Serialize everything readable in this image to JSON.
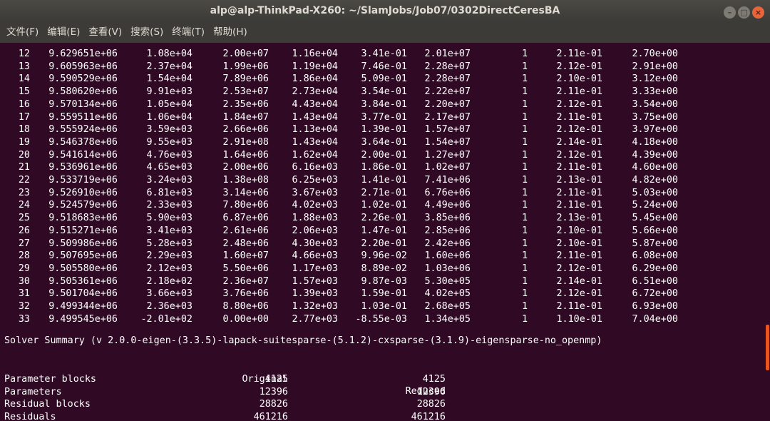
{
  "window": {
    "title": "alp@alp-ThinkPad-X260: ~/SlamJobs/Job07/0302DirectCeresBA",
    "buttons": {
      "minimize": "–",
      "maximize": "□",
      "close": "×"
    }
  },
  "menu": [
    "文件(F)",
    "编辑(E)",
    "查看(V)",
    "搜索(S)",
    "终端(T)",
    "帮助(H)"
  ],
  "iterations": [
    [
      "12",
      "9.629651e+06",
      "1.08e+04",
      "2.00e+07",
      "1.16e+04",
      "3.41e-01",
      "2.01e+07",
      "1",
      "2.11e-01",
      "2.70e+00"
    ],
    [
      "13",
      "9.605963e+06",
      "2.37e+04",
      "1.99e+06",
      "1.19e+04",
      "7.46e-01",
      "2.28e+07",
      "1",
      "2.12e-01",
      "2.91e+00"
    ],
    [
      "14",
      "9.590529e+06",
      "1.54e+04",
      "7.89e+06",
      "1.86e+04",
      "5.09e-01",
      "2.28e+07",
      "1",
      "2.10e-01",
      "3.12e+00"
    ],
    [
      "15",
      "9.580620e+06",
      "9.91e+03",
      "2.53e+07",
      "2.73e+04",
      "3.54e-01",
      "2.22e+07",
      "1",
      "2.11e-01",
      "3.33e+00"
    ],
    [
      "16",
      "9.570134e+06",
      "1.05e+04",
      "2.35e+06",
      "4.43e+04",
      "3.84e-01",
      "2.20e+07",
      "1",
      "2.12e-01",
      "3.54e+00"
    ],
    [
      "17",
      "9.559511e+06",
      "1.06e+04",
      "1.84e+07",
      "1.43e+04",
      "3.77e-01",
      "2.17e+07",
      "1",
      "2.11e-01",
      "3.75e+00"
    ],
    [
      "18",
      "9.555924e+06",
      "3.59e+03",
      "2.66e+06",
      "1.13e+04",
      "1.39e-01",
      "1.57e+07",
      "1",
      "2.12e-01",
      "3.97e+00"
    ],
    [
      "19",
      "9.546378e+06",
      "9.55e+03",
      "2.91e+08",
      "1.43e+04",
      "3.64e-01",
      "1.54e+07",
      "1",
      "2.14e-01",
      "4.18e+00"
    ],
    [
      "20",
      "9.541614e+06",
      "4.76e+03",
      "1.64e+06",
      "1.62e+04",
      "2.00e-01",
      "1.27e+07",
      "1",
      "2.12e-01",
      "4.39e+00"
    ],
    [
      "21",
      "9.536961e+06",
      "4.65e+03",
      "2.00e+06",
      "6.16e+03",
      "1.86e-01",
      "1.02e+07",
      "1",
      "2.11e-01",
      "4.60e+00"
    ],
    [
      "22",
      "9.533719e+06",
      "3.24e+03",
      "1.38e+08",
      "6.25e+03",
      "1.41e-01",
      "7.41e+06",
      "1",
      "2.13e-01",
      "4.82e+00"
    ],
    [
      "23",
      "9.526910e+06",
      "6.81e+03",
      "3.14e+06",
      "3.67e+03",
      "2.71e-01",
      "6.76e+06",
      "1",
      "2.11e-01",
      "5.03e+00"
    ],
    [
      "24",
      "9.524579e+06",
      "2.33e+03",
      "7.80e+06",
      "4.02e+03",
      "1.02e-01",
      "4.49e+06",
      "1",
      "2.11e-01",
      "5.24e+00"
    ],
    [
      "25",
      "9.518683e+06",
      "5.90e+03",
      "6.87e+06",
      "1.88e+03",
      "2.26e-01",
      "3.85e+06",
      "1",
      "2.13e-01",
      "5.45e+00"
    ],
    [
      "26",
      "9.515271e+06",
      "3.41e+03",
      "2.61e+06",
      "2.06e+03",
      "1.47e-01",
      "2.85e+06",
      "1",
      "2.10e-01",
      "5.66e+00"
    ],
    [
      "27",
      "9.509986e+06",
      "5.28e+03",
      "2.48e+06",
      "4.30e+03",
      "2.20e-01",
      "2.42e+06",
      "1",
      "2.10e-01",
      "5.87e+00"
    ],
    [
      "28",
      "9.507695e+06",
      "2.29e+03",
      "1.60e+07",
      "4.66e+03",
      "9.96e-02",
      "1.60e+06",
      "1",
      "2.11e-01",
      "6.08e+00"
    ],
    [
      "29",
      "9.505580e+06",
      "2.12e+03",
      "5.50e+06",
      "1.17e+03",
      "8.89e-02",
      "1.03e+06",
      "1",
      "2.12e-01",
      "6.29e+00"
    ],
    [
      "30",
      "9.505361e+06",
      "2.18e+02",
      "2.36e+07",
      "1.57e+03",
      "9.87e-03",
      "5.30e+05",
      "1",
      "2.14e-01",
      "6.51e+00"
    ],
    [
      "31",
      "9.501704e+06",
      "3.66e+03",
      "3.76e+06",
      "1.39e+03",
      "1.59e-01",
      "4.02e+05",
      "1",
      "2.12e-01",
      "6.72e+00"
    ],
    [
      "32",
      "9.499344e+06",
      "2.36e+03",
      "8.80e+06",
      "1.32e+03",
      "1.03e-01",
      "2.68e+05",
      "1",
      "2.11e-01",
      "6.93e+00"
    ],
    [
      "33",
      "9.499545e+06",
      "-2.01e+02",
      "0.00e+00",
      "2.77e+03",
      "-8.55e-03",
      "1.34e+05",
      "1",
      "1.10e-01",
      "7.04e+00"
    ]
  ],
  "summary_title": "Solver Summary (v 2.0.0-eigen-(3.3.5)-lapack-suitesparse-(5.1.2)-cxsparse-(3.1.9)-eigensparse-no_openmp)",
  "summary_headers": {
    "original": "Original",
    "reduced": "Reduced"
  },
  "summary_rows": [
    {
      "label": "Parameter blocks",
      "original": "4125",
      "reduced": "4125"
    },
    {
      "label": "Parameters",
      "original": "12396",
      "reduced": "12396"
    },
    {
      "label": "Residual blocks",
      "original": "28826",
      "reduced": "28826"
    },
    {
      "label": "Residuals",
      "original": "461216",
      "reduced": "461216"
    }
  ],
  "colors": {
    "terminal_bg": "#300a24",
    "text": "#ffffff",
    "titlebar": "#3c3b37",
    "accent": "#e95420"
  }
}
